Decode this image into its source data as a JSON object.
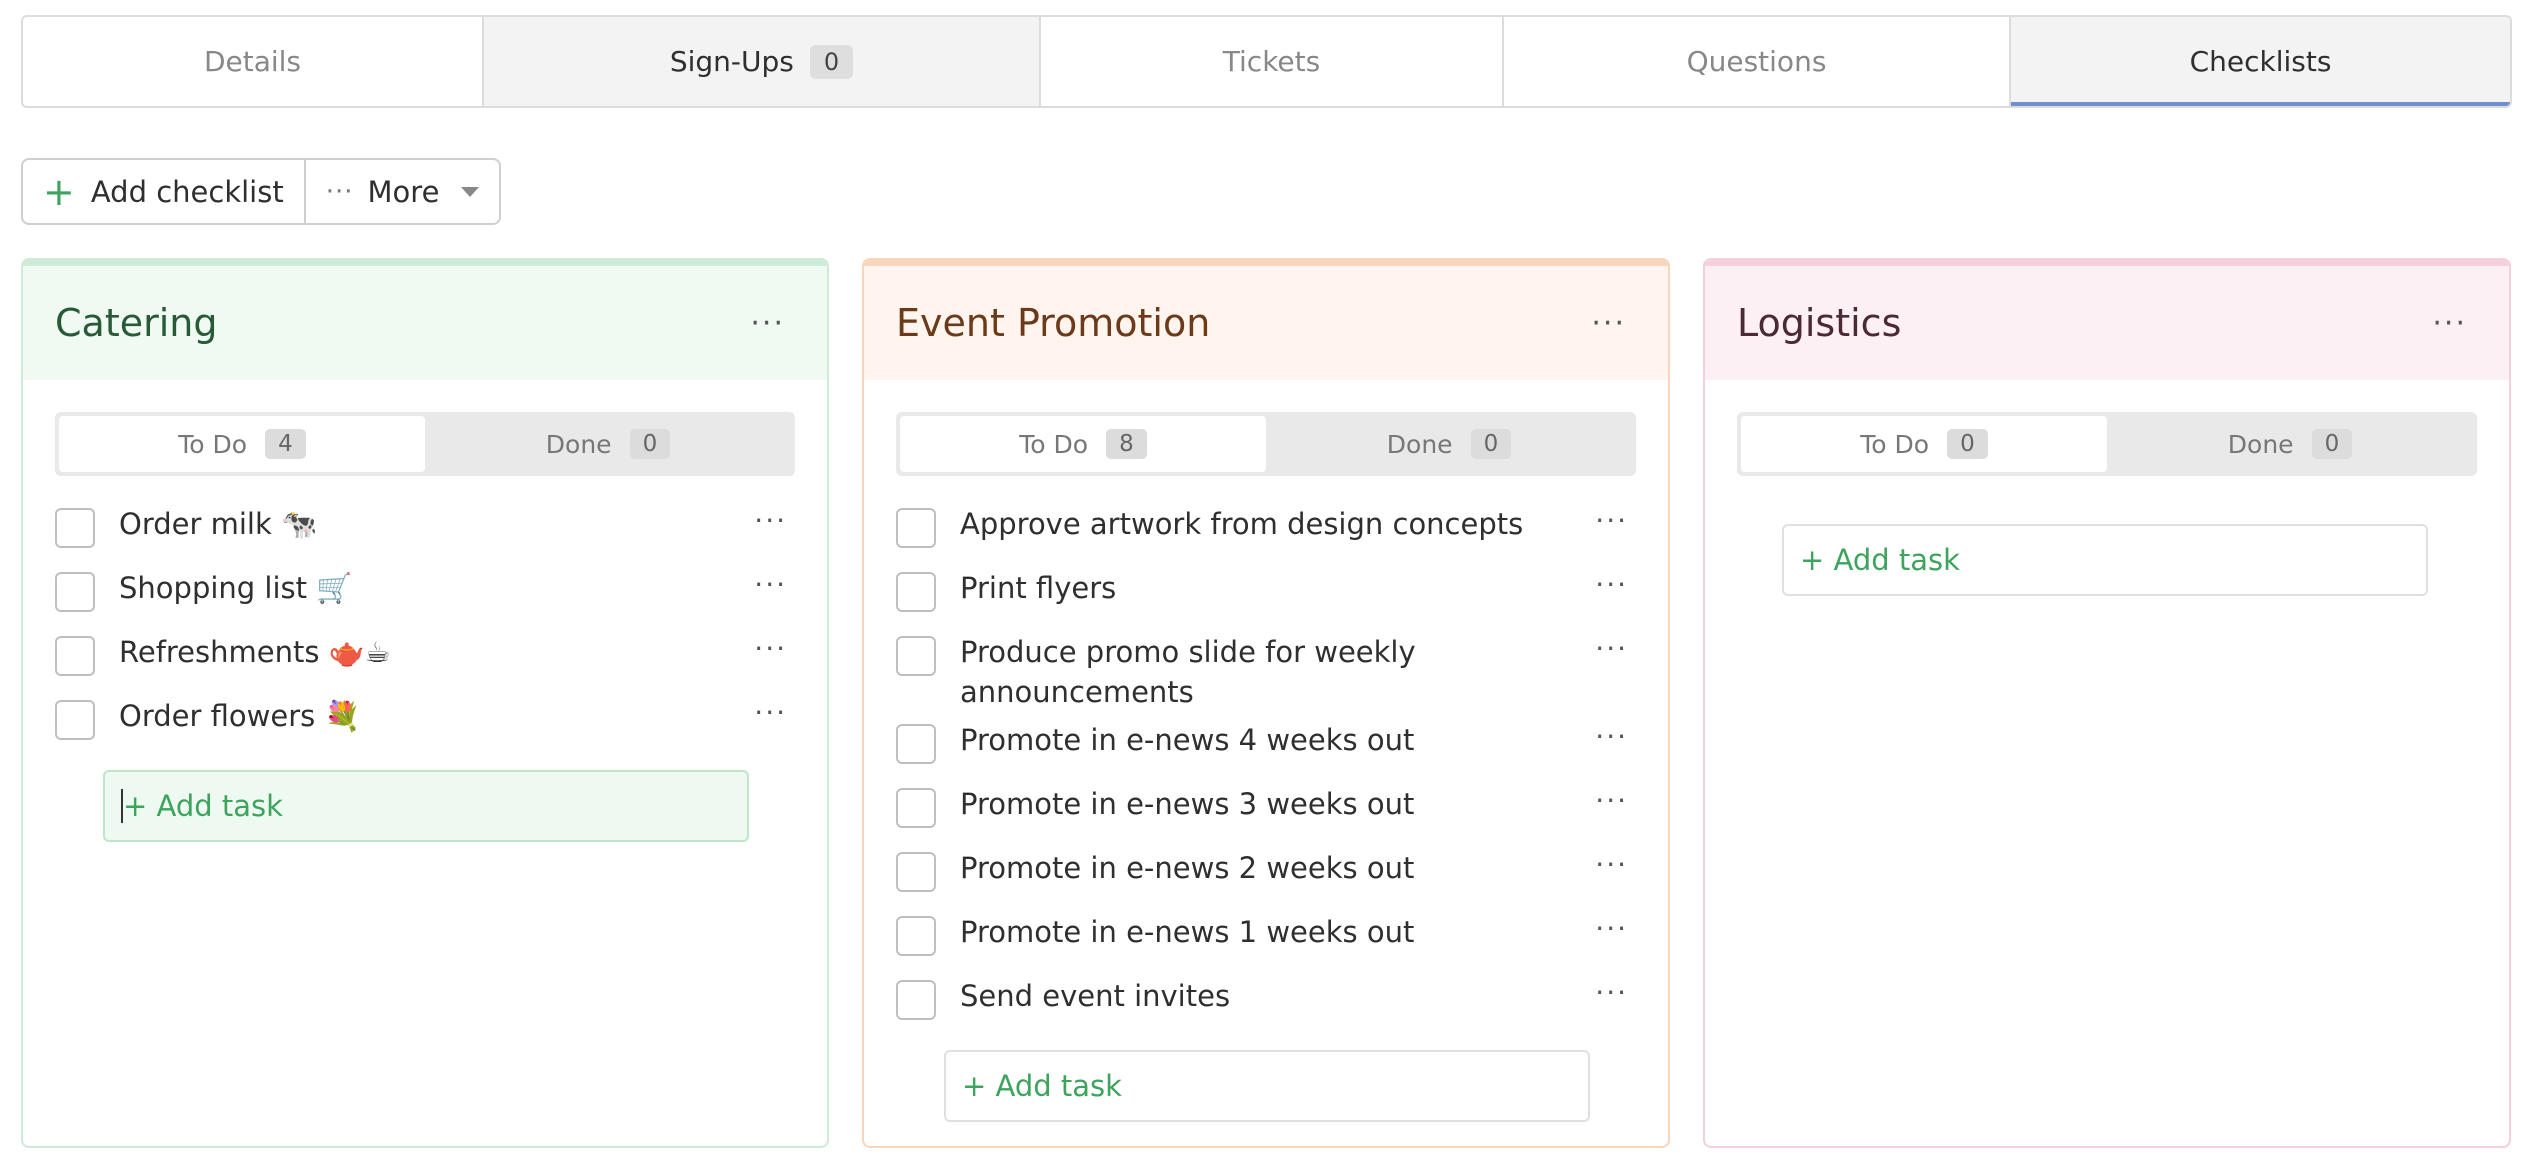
{
  "tabs": [
    {
      "label": "Details"
    },
    {
      "label": "Sign-Ups",
      "badge": "0"
    },
    {
      "label": "Tickets"
    },
    {
      "label": "Questions"
    },
    {
      "label": "Checklists"
    }
  ],
  "toolbar": {
    "add_label": "Add checklist",
    "more_label": "More",
    "plus_glyph": "+",
    "more_glyph": "···"
  },
  "colors": {
    "catering": "#cdebd6",
    "promotion": "#f7d6bd",
    "logistics": "#f4cfdc",
    "accent_green": "#3da35d",
    "active_tab_underline": "#6f8fcc"
  },
  "columns": [
    {
      "title": "Catering",
      "menu": "···",
      "todo_label": "To Do",
      "todo_count": "4",
      "done_label": "Done",
      "done_count": "0",
      "tasks": [
        {
          "text": "Order milk 🐄",
          "more": "···"
        },
        {
          "text": "Shopping list 🛒",
          "more": "···"
        },
        {
          "text": "Refreshments 🫖☕",
          "more": "···"
        },
        {
          "text": "Order flowers 💐",
          "more": "···"
        }
      ],
      "add_task": "+ Add task"
    },
    {
      "title": "Event Promotion",
      "menu": "···",
      "todo_label": "To Do",
      "todo_count": "8",
      "done_label": "Done",
      "done_count": "0",
      "tasks": [
        {
          "text": "Approve artwork from design concepts",
          "more": "···"
        },
        {
          "text": "Print flyers",
          "more": "···"
        },
        {
          "text": "Produce promo slide for weekly announcements",
          "more": "···"
        },
        {
          "text": "Promote in e-news 4 weeks out",
          "more": "···"
        },
        {
          "text": "Promote in e-news 3 weeks out",
          "more": "···"
        },
        {
          "text": "Promote in e-news 2 weeks out",
          "more": "···"
        },
        {
          "text": "Promote in e-news 1 weeks out",
          "more": "···"
        },
        {
          "text": "Send event invites",
          "more": "···"
        }
      ],
      "add_task": "+ Add task"
    },
    {
      "title": "Logistics",
      "menu": "···",
      "todo_label": "To Do",
      "todo_count": "0",
      "done_label": "Done",
      "done_count": "0",
      "tasks": [],
      "add_task": "+ Add task"
    }
  ]
}
